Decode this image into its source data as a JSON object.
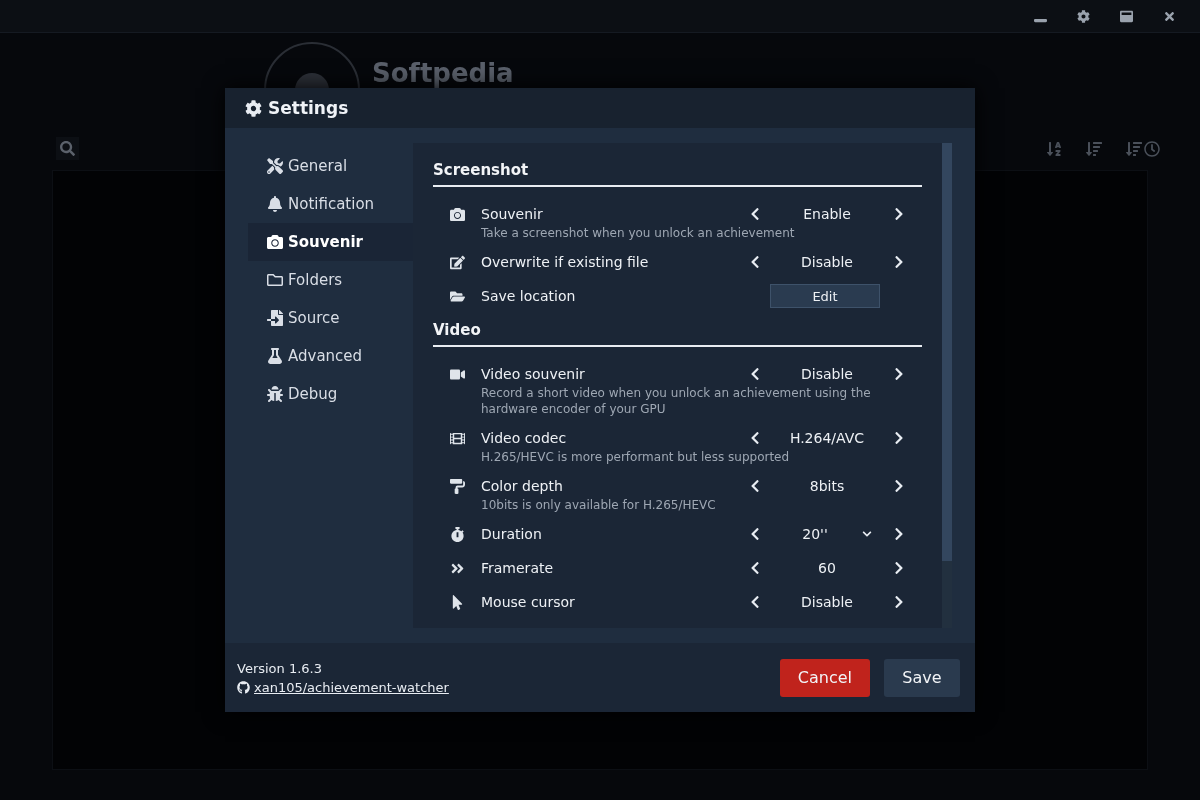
{
  "app": {
    "profile_name": "Softpedia"
  },
  "dialog": {
    "title": "Settings",
    "sidebar": {
      "items": [
        {
          "label": "General",
          "selected": false
        },
        {
          "label": "Notification",
          "selected": false
        },
        {
          "label": "Souvenir",
          "selected": true
        },
        {
          "label": "Folders",
          "selected": false
        },
        {
          "label": "Source",
          "selected": false
        },
        {
          "label": "Advanced",
          "selected": false
        },
        {
          "label": "Debug",
          "selected": false
        }
      ]
    },
    "sections": [
      {
        "title": "Screenshot",
        "rows": [
          {
            "label": "Souvenir",
            "description": "Take a screenshot when you unlock an achievement",
            "kind": "stepper",
            "value": "Enable"
          },
          {
            "label": "Overwrite if existing file",
            "kind": "stepper",
            "value": "Disable"
          },
          {
            "label": "Save location",
            "kind": "button",
            "value": "Edit"
          }
        ]
      },
      {
        "title": "Video",
        "rows": [
          {
            "label": "Video souvenir",
            "description": "Record a short video when you unlock an achievement using the hardware encoder of your GPU",
            "kind": "stepper",
            "value": "Disable"
          },
          {
            "label": "Video codec",
            "description": "H.265/HEVC is more performant but less supported",
            "kind": "stepper",
            "value": "H.264/AVC"
          },
          {
            "label": "Color depth",
            "description": "10bits is only available for H.265/HEVC",
            "kind": "stepper",
            "value": "8bits"
          },
          {
            "label": "Duration",
            "kind": "dropdown",
            "value": "20''"
          },
          {
            "label": "Framerate",
            "kind": "stepper",
            "value": "60"
          },
          {
            "label": "Mouse cursor",
            "kind": "stepper",
            "value": "Disable"
          }
        ]
      }
    ],
    "footer": {
      "version": "Version 1.6.3",
      "link": "xan105/achievement-watcher",
      "buttons": [
        {
          "label": "Cancel",
          "kind": "danger"
        },
        {
          "label": "Save",
          "kind": "primary"
        }
      ]
    }
  }
}
